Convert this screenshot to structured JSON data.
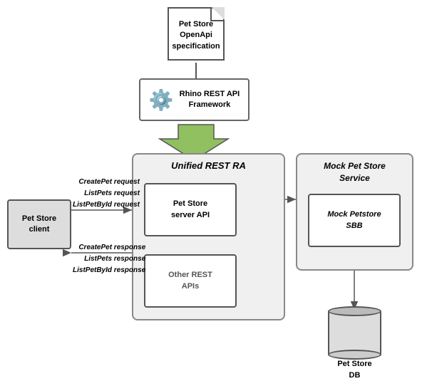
{
  "doc": {
    "label_line1": "Pet Store",
    "label_line2": "OpenApi",
    "label_line3": "specification"
  },
  "rhino": {
    "label_line1": "Rhino REST API",
    "label_line2": "Framework"
  },
  "unified": {
    "title": "Unified REST RA",
    "petstore_api": "Pet Store\nserver API",
    "other_apis": "Other REST\nAPIs"
  },
  "mock": {
    "title_line1": "Mock Pet Store",
    "title_line2": "Service",
    "sbb": "Mock Petstore\nSBB"
  },
  "client": {
    "label": "Pet Store\nclient"
  },
  "db": {
    "label_line1": "Pet Store",
    "label_line2": "DB"
  },
  "requests": {
    "line1": "CreatePet request",
    "line2": "ListPets request",
    "line3": "ListPetById request"
  },
  "responses": {
    "line1": "CreatePet response",
    "line2": "ListPets response",
    "line3": "ListPetById response"
  }
}
